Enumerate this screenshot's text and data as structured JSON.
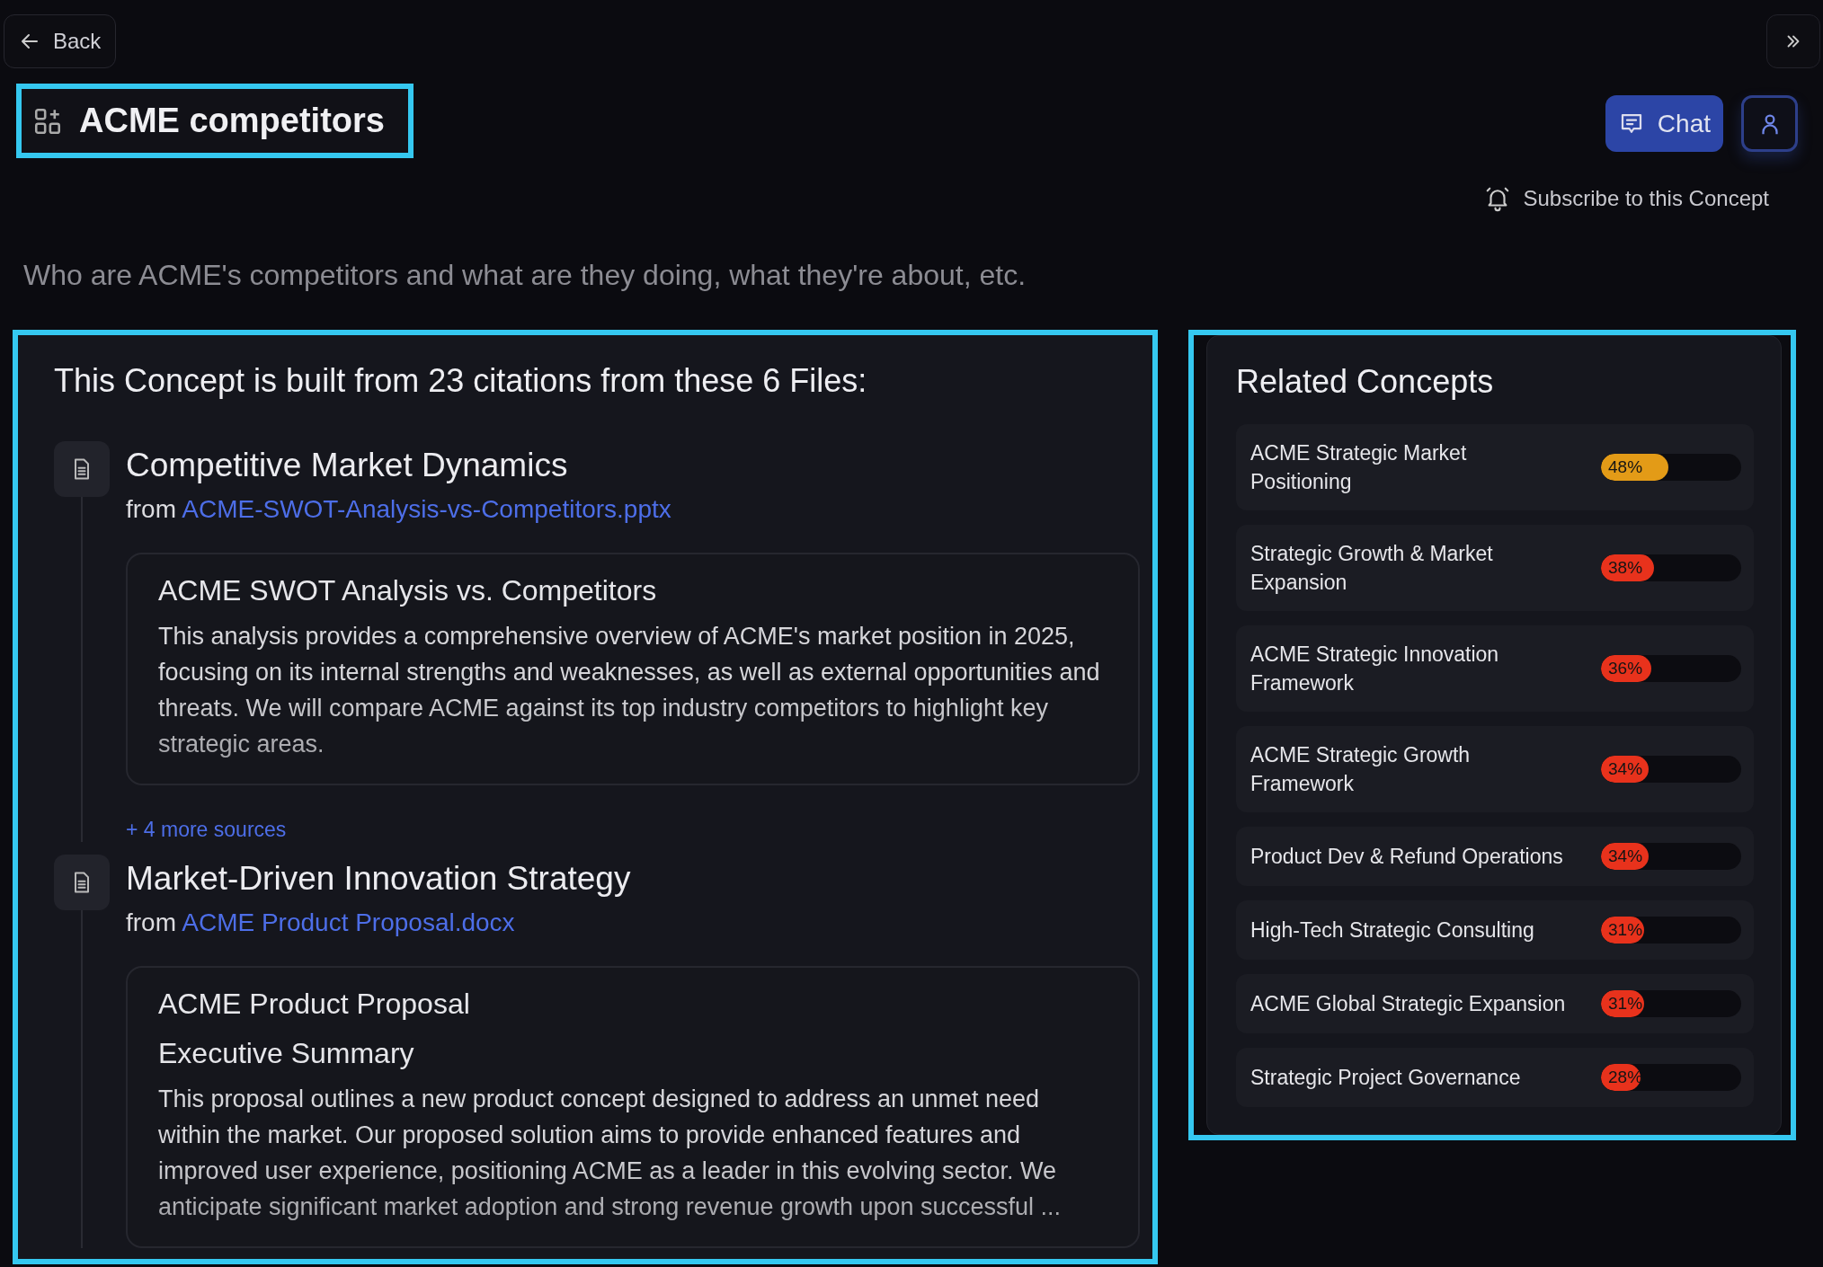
{
  "nav": {
    "back": "Back"
  },
  "concept": {
    "title": "ACME competitors",
    "chat": "Chat",
    "subscribe": "Subscribe to this Concept",
    "description": "Who are ACME's competitors and what are they doing, what they're about, etc."
  },
  "sources": {
    "heading": "This Concept is built from 23 citations from these 6 Files:",
    "files": [
      {
        "title": "Competitive Market Dynamics",
        "from": "from",
        "filename": "ACME-SWOT-Analysis-vs-Competitors.pptx",
        "excerpt": {
          "title": "ACME SWOT Analysis vs. Competitors",
          "paragraph": "This analysis provides a comprehensive overview of ACME's market position in 2025, focusing on its internal strengths and weaknesses, as well as external opportunities and threats. We will compare ACME against its top industry competitors to highlight key strategic areas."
        },
        "more": "+ 4 more sources"
      },
      {
        "title": "Market-Driven Innovation Strategy",
        "from": "from",
        "filename": "ACME Product Proposal.docx",
        "excerpt": {
          "title": "ACME Product Proposal",
          "subtitle": "Executive Summary",
          "paragraph": "This proposal outlines a new product concept designed to address an unmet need within the market. Our proposed solution aims to provide enhanced features and improved user experience, positioning ACME as a leader in this evolving sector. We anticipate significant market adoption and strong revenue growth upon successful ..."
        }
      }
    ]
  },
  "related": {
    "heading": "Related Concepts",
    "items": [
      {
        "name": "ACME Strategic Market Positioning",
        "percent": "48%",
        "level": 0.48,
        "color": "#e39b17"
      },
      {
        "name": "Strategic Growth & Market Expansion",
        "percent": "38%",
        "level": 0.38,
        "color": "#e8321c"
      },
      {
        "name": "ACME Strategic Innovation Framework",
        "percent": "36%",
        "level": 0.36,
        "color": "#e8321c"
      },
      {
        "name": "ACME Strategic Growth Framework",
        "percent": "34%",
        "level": 0.34,
        "color": "#e8321c"
      },
      {
        "name": "Product Dev & Refund Operations",
        "percent": "34%",
        "level": 0.34,
        "color": "#e8321c"
      },
      {
        "name": "High-Tech Strategic Consulting",
        "percent": "31%",
        "level": 0.31,
        "color": "#e8321c"
      },
      {
        "name": "ACME Global Strategic Expansion",
        "percent": "31%",
        "level": 0.31,
        "color": "#e8321c"
      },
      {
        "name": "Strategic Project Governance",
        "percent": "28%",
        "level": 0.28,
        "color": "#e8321c"
      }
    ]
  }
}
